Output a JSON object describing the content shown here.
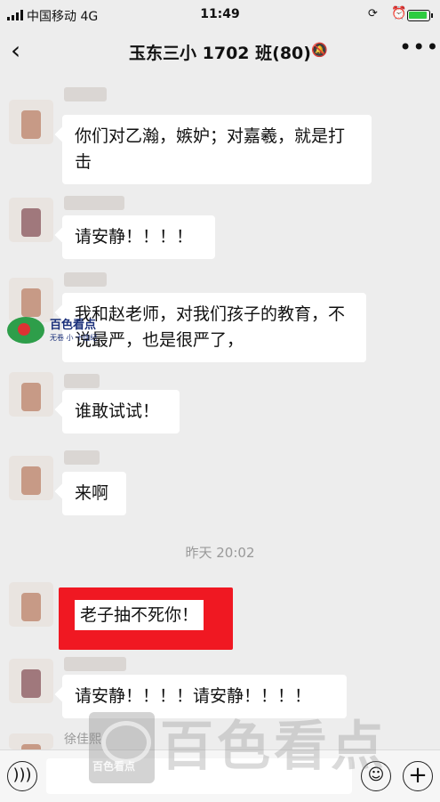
{
  "status_bar": {
    "carrier": "中国移动",
    "network": "4G",
    "time": "11:49",
    "lock_icon": "rotation-lock-icon",
    "alarm_icon": "alarm-icon",
    "battery_icon": "battery-icon"
  },
  "nav": {
    "back_icon": "chevron-left-icon",
    "title": "玉东三小 1702 班(80)",
    "mute_icon": "bell-muted-icon",
    "more_icon": "more-dots-icon"
  },
  "messages": [
    {
      "text": "你们对乙瀚，嫉妒；对嘉羲，就是打击"
    },
    {
      "text": "请安静！！！！"
    },
    {
      "text": "我和赵老师，对我们孩子的教育，不说最严，也是很严了，"
    },
    {
      "text": "谁敢试试！"
    },
    {
      "text": "来啊"
    },
    {
      "text": "老子抽不死你！",
      "highlighted": true
    },
    {
      "text": "请安静！！！！请安静！！！！"
    }
  ],
  "time_divider": "昨天 20:02",
  "partial_sender": "徐佳熙",
  "watermark": {
    "top_text": "百色看点",
    "top_sub": "无卷 小 十佳纪",
    "bottom_label": "百色看点",
    "bottom_big": "百色看点"
  },
  "input_bar": {
    "voice_icon": "voice-icon",
    "emoji_icon": "emoji-icon",
    "plus_icon": "plus-icon"
  },
  "colors": {
    "background": "#ededed",
    "bubble": "#ffffff",
    "highlight": "#f01822",
    "battery": "#2ecc40"
  }
}
